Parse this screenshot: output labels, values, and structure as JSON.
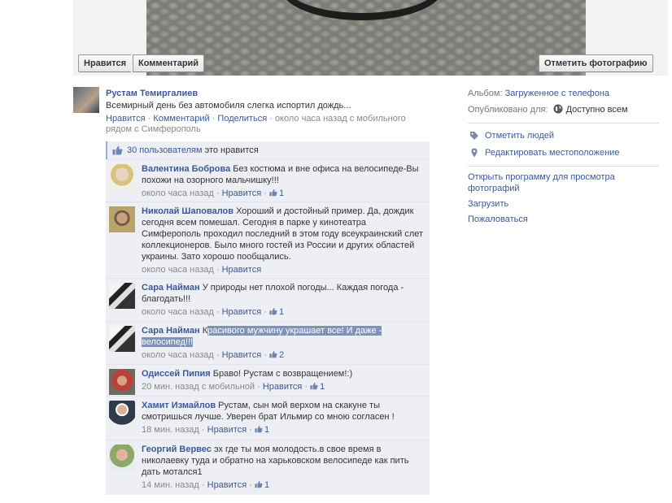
{
  "photo_actions": {
    "like": "Нравится",
    "comment": "Комментарий",
    "tag_photo": "Отметить фотографию"
  },
  "post": {
    "author": "Рустам Темиргалиев",
    "text": "Всемирный день без автомобиля слегка испортил дождь...",
    "like": "Нравится",
    "comment": "Комментарий",
    "share": "Поделиться",
    "time": "около часа назад с мобильного рядом с Симферополь",
    "sep": " · "
  },
  "likes": {
    "count_text": "30 пользователям",
    "suffix": " это нравится"
  },
  "comments": [
    {
      "author": "Валентина Боброва",
      "text": "Без костюма и вне офиса на велосипеде-Вы похожи на озорного мальчишку!!!",
      "time": "около часа назад",
      "like": "Нравится",
      "likes": "1"
    },
    {
      "author": "Николай Шаповалов",
      "text": "Хороший и достойный пример. Да, дождик сегодня всем помешал. Сегодня в парке у кинотеатра Симферополь проходил последний в этом году всеукраинский слет коллекционеров. Было много гостей из России и других областей украины. Зато хорошо пообщались.",
      "time": "около часа назад",
      "like": "Нравится",
      "likes": ""
    },
    {
      "author": "Сара Найман",
      "text": "У природы нет плохой погоды... Каждая погода - благодать!!!",
      "time": "около часа назад",
      "like": "Нравится",
      "likes": "1"
    },
    {
      "author": "Сара Найман",
      "text_first": "К",
      "text_selected": "расивого мужчину украшает все! И даже - велосипед!!!",
      "time": "около часа назад",
      "like": "Нравится",
      "likes": "2"
    },
    {
      "author": "Одиссей Пипия",
      "text": "Браво! Рустам с возвращением!:)",
      "time": "20 мин. назад с мобильной",
      "like": "Нравится",
      "likes": "1"
    },
    {
      "author": "Хамит Измайлов",
      "text": "Рустам, сын мой верхом на скакуне ты смотришься лучше. Уверен брат Ильмир со мною согласен !",
      "time": "18 мин. назад",
      "like": "Нравится",
      "likes": "1"
    },
    {
      "author": "Георгий Вервес",
      "text": "эх где ты моя молодость.в свое время в николаевку туда и обратно на харьковском велосипеде как пить дать мотался1",
      "time": "14 мин. назад",
      "like": "Нравится",
      "likes": "1"
    }
  ],
  "sidebar": {
    "album_label": "Альбом:",
    "album_value": "Загруженное с телефона",
    "published_label": "Опубликовано для:",
    "published_value": "Доступно всем",
    "tag_people": "Отметить людей",
    "edit_location": "Редактировать местоположение",
    "open_viewer": "Открыть программу для просмотра фотографий",
    "upload": "Загрузить",
    "report": "Пожаловаться"
  },
  "icons": {
    "globe": "globe-icon",
    "tag": "tag-icon",
    "location": "location-pin-icon",
    "thumb": "thumbs-up-icon"
  },
  "colors": {
    "link": "#3b5998",
    "comment_bg": "#edeff4",
    "selection": "#7f92b8"
  }
}
